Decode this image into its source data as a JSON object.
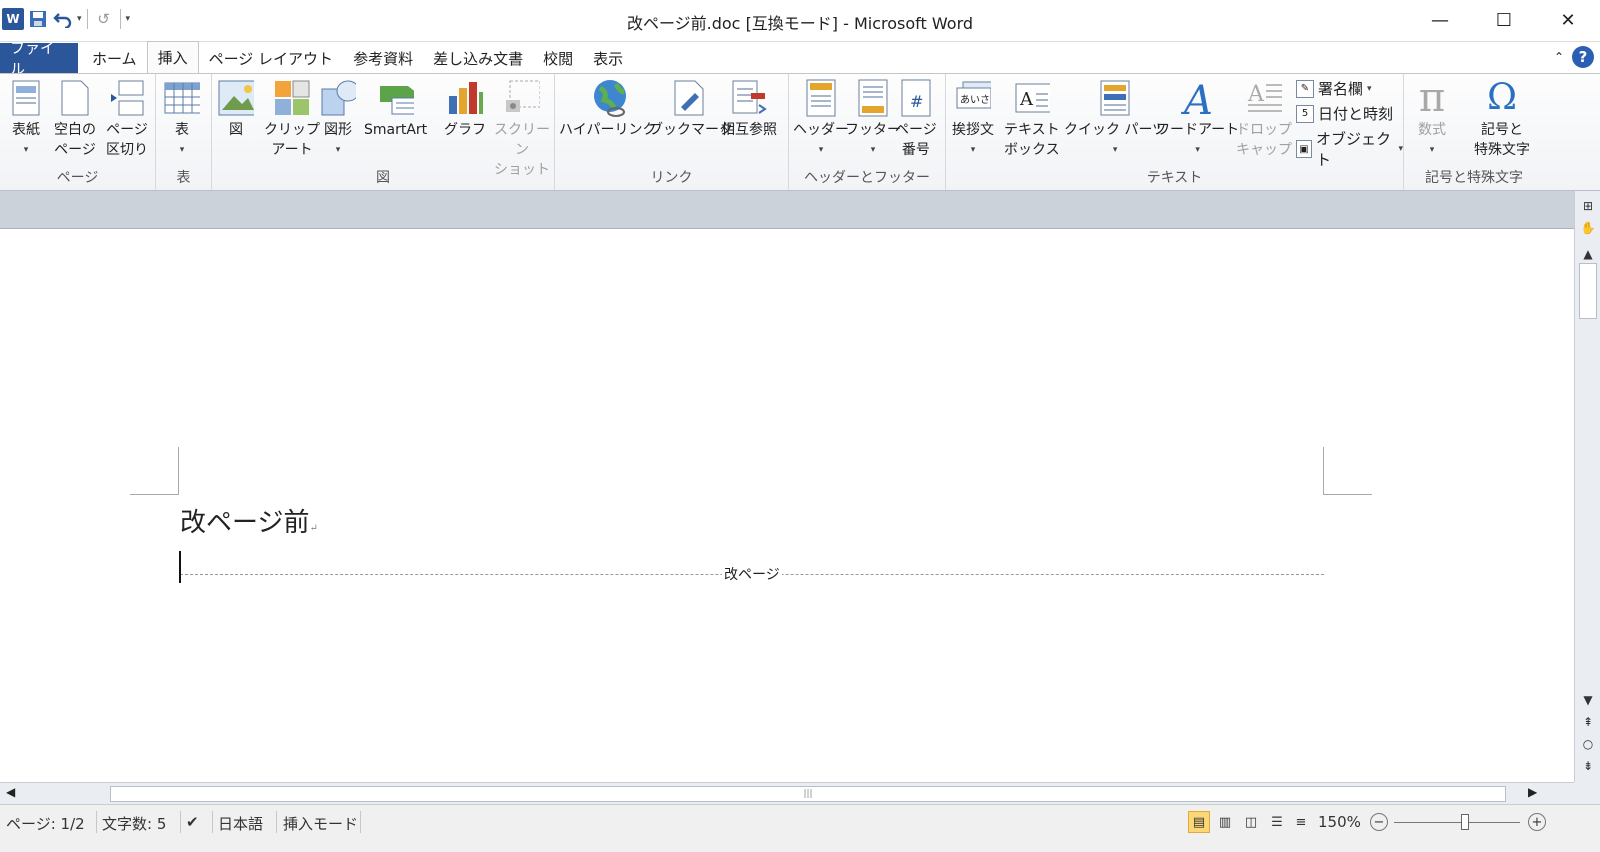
{
  "window": {
    "title": "改ページ前.doc [互換モード] - Microsoft Word",
    "logo": "W"
  },
  "qat": {
    "save": "save-icon",
    "undo": "undo-icon",
    "redo": "redo-icon",
    "customize": "customize-icon"
  },
  "tabs": [
    {
      "label": "ファイル"
    },
    {
      "label": "ホーム"
    },
    {
      "label": "挿入"
    },
    {
      "label": "ページ レイアウト"
    },
    {
      "label": "参考資料"
    },
    {
      "label": "差し込み文書"
    },
    {
      "label": "校閲"
    },
    {
      "label": "表示"
    }
  ],
  "ribbon": {
    "groups": {
      "page": "ページ",
      "table": "表",
      "illustrations": "図",
      "links": "リンク",
      "header_footer": "ヘッダーとフッター",
      "text": "テキスト",
      "symbols": "記号と特殊文字"
    },
    "buttons": {
      "cover": [
        "表紙",
        ""
      ],
      "blank": [
        "空白の",
        "ページ"
      ],
      "pagebreak": [
        "ページ",
        "区切り"
      ],
      "table": [
        "表",
        ""
      ],
      "picture": [
        "図",
        ""
      ],
      "clipart": [
        "クリップ",
        "アート"
      ],
      "shapes": [
        "図形",
        ""
      ],
      "smartart": [
        "SmartArt",
        ""
      ],
      "chart": [
        "グラフ",
        ""
      ],
      "screenshot": [
        "スクリーン",
        "ショット"
      ],
      "hyperlink": [
        "ハイパーリンク",
        ""
      ],
      "bookmark": [
        "ブックマーク",
        ""
      ],
      "crossref": [
        "相互参照",
        ""
      ],
      "header": [
        "ヘッダー",
        ""
      ],
      "footer": [
        "フッター",
        ""
      ],
      "pagenum": [
        "ページ",
        "番号"
      ],
      "greeting": [
        "挨拶文",
        ""
      ],
      "textbox": [
        "テキスト",
        "ボックス"
      ],
      "quickparts": [
        "クイック パーツ",
        ""
      ],
      "wordart": [
        "ワードアート",
        ""
      ],
      "dropcap": [
        "ドロップ",
        "キャップ"
      ],
      "signature": "署名欄",
      "datetime": "日付と時刻",
      "object": "オブジェクト",
      "equation": [
        "数式",
        ""
      ],
      "symbol": [
        "記号と",
        "特殊文字"
      ]
    }
  },
  "document": {
    "heading": "改ページ前",
    "break_label": "改ページ"
  },
  "status": {
    "page": "ページ: 1/2",
    "chars": "文字数: 5",
    "lang": "日本語",
    "mode": "挿入モード",
    "zoom": "150%"
  }
}
